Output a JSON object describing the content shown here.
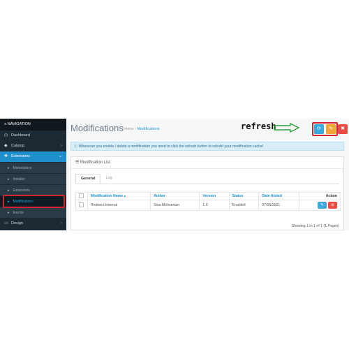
{
  "sidebar": {
    "heading": "≡ NAVIGATION",
    "items": [
      {
        "label": "Dashboard",
        "icon": "dashboard-icon",
        "glyph": "◷"
      },
      {
        "label": "Catalog",
        "icon": "tag-icon",
        "glyph": "◆"
      },
      {
        "label": "Extensions",
        "icon": "puzzle-icon",
        "glyph": "✚"
      },
      {
        "label": "Design",
        "icon": "monitor-icon",
        "glyph": "▭"
      }
    ],
    "sub_items": [
      {
        "label": "Marketplace"
      },
      {
        "label": "Installer"
      },
      {
        "label": "Extensions"
      },
      {
        "label": "Modifications"
      },
      {
        "label": "Events"
      }
    ]
  },
  "header": {
    "title": "Modifications",
    "breadcrumb_home": "Home",
    "breadcrumb_sep": "›",
    "breadcrumb_current": "Modifications"
  },
  "annotation": {
    "refresh_label": "refresh",
    "highlight_color": "#d5232f",
    "arrow_color": "#2e9e3a"
  },
  "toolbar": {
    "refresh_glyph": "⟳",
    "clear_glyph": "✎",
    "delete_glyph": "✖"
  },
  "alert": {
    "icon": "info-icon",
    "text": "ⓘ Whenever you enable / delete a modification you need to click the refresh button to rebuild your modification cache!"
  },
  "panel": {
    "title": "☰ Modification List",
    "tabs": [
      "General",
      "Log"
    ],
    "columns": [
      "Modification Name ▴",
      "Author",
      "Version",
      "Status",
      "Date Added",
      "Action"
    ],
    "rows": [
      {
        "name": "Redirect Internal",
        "author": "Sina Mohsenian",
        "version": "1.0",
        "status": "Enabled",
        "date_added": "07/05/2021",
        "edit_glyph": "✎",
        "disable_glyph": "⊖"
      }
    ],
    "showing": "Showing 1 to 1 of 1 (1 Pages)"
  },
  "colors": {
    "sidebar_bg": "#1e2a33",
    "active_blue": "#1f90cc",
    "info_btn": "#3aa9e0",
    "warning_btn": "#f3a638",
    "danger_btn": "#ec4b45"
  }
}
